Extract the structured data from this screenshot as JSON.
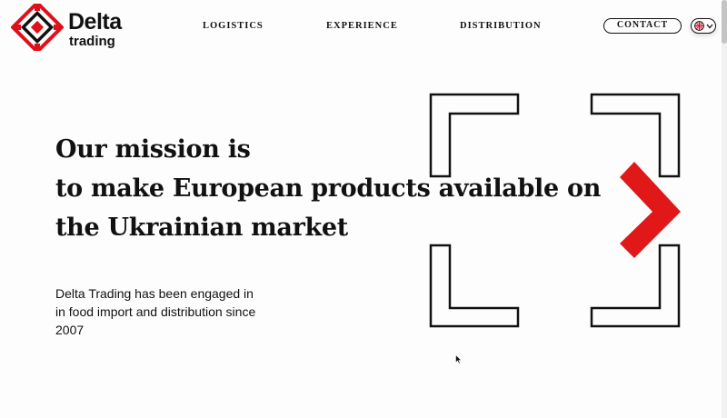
{
  "header": {
    "logo": {
      "name": "Delta",
      "sub": "trading",
      "colors": {
        "red": "#e0101a",
        "dark": "#111111"
      }
    },
    "nav": [
      {
        "label": "LOGISTICS"
      },
      {
        "label": "EXPERIENCE"
      },
      {
        "label": "DISTRIBUTION"
      }
    ],
    "contact_label": "CONTACT",
    "language": {
      "icon": "uk-flag-icon",
      "dropdown_icon": "chevron-down-icon"
    }
  },
  "hero": {
    "mission_lines": [
      "Our mission is",
      "to make European products available on",
      "the Ukrainian market"
    ],
    "subtitle_lines": [
      "Delta Trading has been engaged in",
      "in food import and distribution since",
      "2007"
    ],
    "accent_color": "#e01818"
  }
}
